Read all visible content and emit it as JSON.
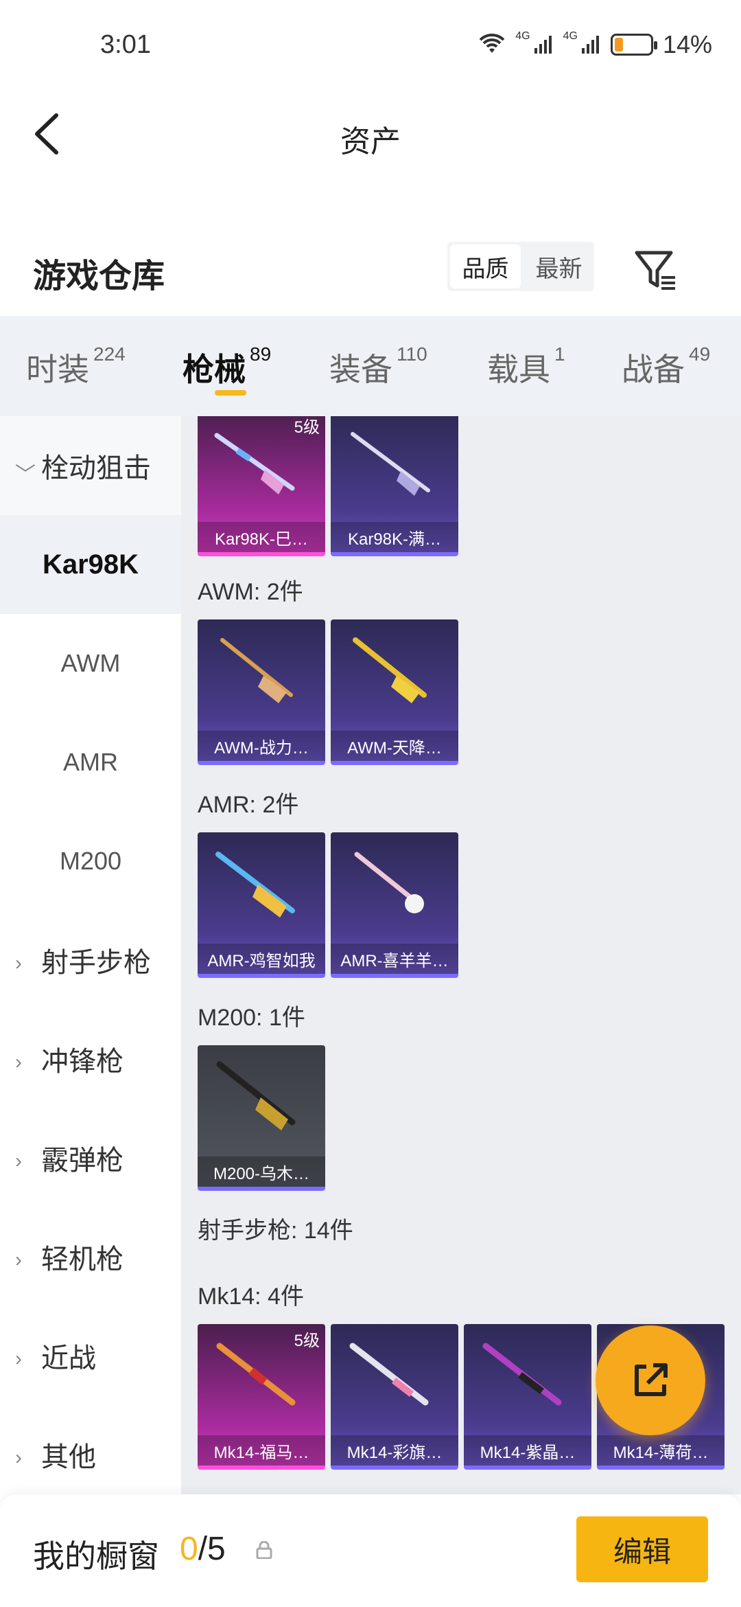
{
  "status": {
    "time": "3:01",
    "net1": "4G",
    "net2": "4G",
    "battery": "14%",
    "battery_level": 0.14
  },
  "header": {
    "title": "资产"
  },
  "section": {
    "title": "游戏仓库",
    "sort_quality": "品质",
    "sort_newest": "最新"
  },
  "tabs": [
    {
      "label": "时装",
      "count": "224"
    },
    {
      "label": "枪械",
      "count": "89"
    },
    {
      "label": "装备",
      "count": "110"
    },
    {
      "label": "载具",
      "count": "1"
    },
    {
      "label": "战备",
      "count": "49"
    }
  ],
  "sidebar": [
    {
      "label": "栓动狙击",
      "chev": "﹀"
    },
    {
      "label": "Kar98K"
    },
    {
      "label": "AWM"
    },
    {
      "label": "AMR"
    },
    {
      "label": "M200"
    },
    {
      "label": "射手步枪",
      "chev": "›"
    },
    {
      "label": "冲锋枪",
      "chev": "›"
    },
    {
      "label": "霰弹枪",
      "chev": "›"
    },
    {
      "label": "轻机枪",
      "chev": "›"
    },
    {
      "label": "近战",
      "chev": "›"
    },
    {
      "label": "其他",
      "chev": "›"
    }
  ],
  "groups": {
    "awm": "AWM: 2件",
    "amr": "AMR: 2件",
    "m200": "M200: 1件",
    "marksman": "射手步枪: 14件",
    "mk14": "Mk14: 4件"
  },
  "items": {
    "kar1": {
      "name": "Kar98K-巳…",
      "level": "5级"
    },
    "kar2": {
      "name": "Kar98K-满…"
    },
    "awm1": {
      "name": "AWM-战力…"
    },
    "awm2": {
      "name": "AWM-天降…"
    },
    "amr1": {
      "name": "AMR-鸡智如我"
    },
    "amr2": {
      "name": "AMR-喜羊羊…"
    },
    "m2001": {
      "name": "M200-乌木…"
    },
    "mk1": {
      "name": "Mk14-福马…",
      "level": "5级"
    },
    "mk2": {
      "name": "Mk14-彩旗…"
    },
    "mk3": {
      "name": "Mk14-紫晶…"
    },
    "mk4": {
      "name": "Mk14-薄荷…"
    }
  },
  "bottom": {
    "label": "我的橱窗",
    "current": "0",
    "total": "/5",
    "edit": "编辑"
  },
  "colors": {
    "accent": "#f6b81c",
    "purple_card": "#4a3b8c",
    "pink_card": "#a62b9c"
  }
}
